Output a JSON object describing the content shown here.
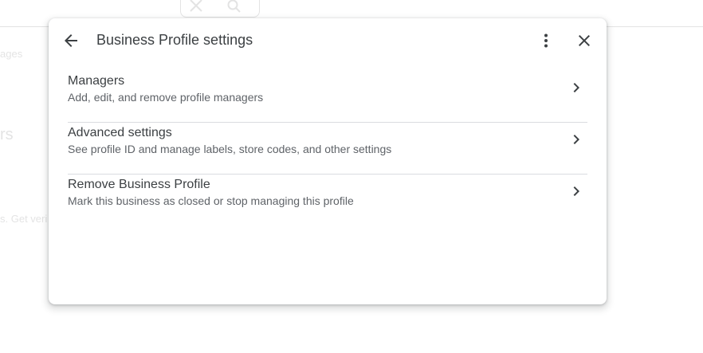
{
  "background": {
    "fragment_tab": "ages",
    "fragment_heading": "rs",
    "fragment_link": "s. Get veri"
  },
  "dialog": {
    "title": "Business Profile settings",
    "items": [
      {
        "title": "Managers",
        "subtitle": "Add, edit, and remove profile managers"
      },
      {
        "title": "Advanced settings",
        "subtitle": "See profile ID and manage labels, store codes, and other settings"
      },
      {
        "title": "Remove Business Profile",
        "subtitle": "Mark this business as closed or stop managing this profile"
      }
    ]
  },
  "icons": {
    "back": "arrow-back-icon",
    "more": "more-vert-icon",
    "close": "close-icon",
    "chevron": "chevron-right-icon"
  },
  "colors": {
    "icon": "#3c4043",
    "title_text": "#3c4043",
    "subtitle_text": "#5f6368",
    "divider": "#dadce0"
  }
}
